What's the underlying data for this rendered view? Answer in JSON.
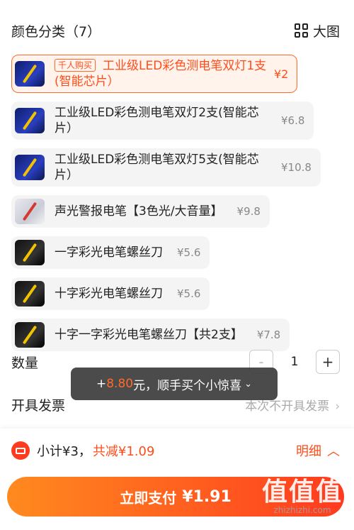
{
  "header": {
    "title": "颜色分类（7）",
    "view_label": "大图"
  },
  "options": [
    {
      "tag": "千人购买",
      "name": "工业级LED彩色测电笔双灯1支(智能芯片）",
      "price": "¥2",
      "selected": true
    },
    {
      "name": "工业级LED彩色测电笔双灯2支(智能芯片）",
      "price": "¥6.8"
    },
    {
      "name": "工业级LED彩色测电笔双灯5支(智能芯片）",
      "price": "¥10.8"
    },
    {
      "name": "声光警报电笔【3色光/大音量】",
      "price": "¥9.8"
    },
    {
      "name": "一字彩光电笔螺丝刀",
      "price": "¥5.6"
    },
    {
      "name": "十字彩光电笔螺丝刀",
      "price": "¥5.6"
    },
    {
      "name": "十字一字彩光电笔螺丝刀【共2支】",
      "price": "¥7.8"
    }
  ],
  "quantity": {
    "label": "数量",
    "minus": "-",
    "value": "1",
    "plus": "+"
  },
  "toast": {
    "prefix": "+",
    "amount": "8.80",
    "suffix": "元，顺手买个小惊喜"
  },
  "invoice": {
    "label": "开具发票",
    "value": "本次不开具发票"
  },
  "summary": {
    "subtotal": "小计¥3，",
    "discount": "共减¥1.09",
    "detail": "明细"
  },
  "pay": {
    "label": "立即支付",
    "amount": "¥1.91"
  },
  "watermark": {
    "big": "值值值",
    "small": "zhizhizhi.com"
  },
  "colors": {
    "accent": "#ff4d1a",
    "pay_gradient_start": "#ff8a1f",
    "pay_gradient_end": "#ff3b1f"
  }
}
